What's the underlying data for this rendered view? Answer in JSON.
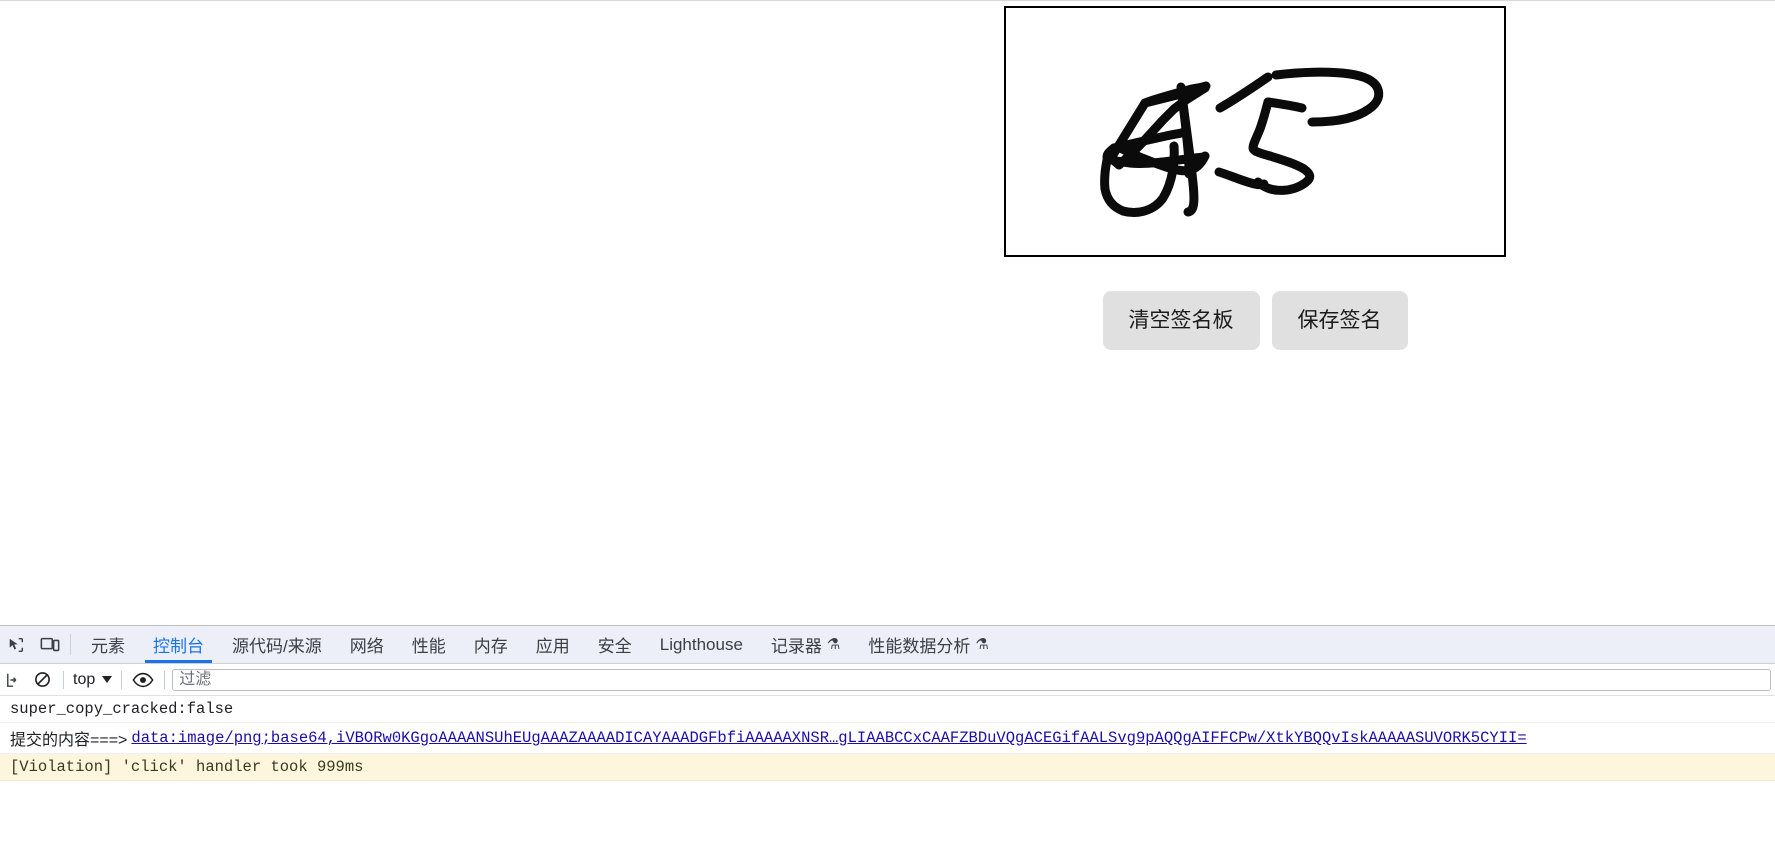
{
  "page": {
    "signature_pad": {
      "name": "signature-canvas",
      "alt_text": "handwritten signature strokes",
      "stroke_color": "#000000",
      "background": "#ffffff",
      "border_color": "#000000"
    },
    "buttons": {
      "clear_label": "清空签名板",
      "save_label": "保存签名",
      "background": "#e0e0e0"
    }
  },
  "devtools": {
    "toolbar_icons": [
      {
        "name": "inspect-element-icon",
        "title": "检查元素"
      },
      {
        "name": "device-toolbar-icon",
        "title": "切换设备工具栏"
      }
    ],
    "tabs": [
      {
        "label": "元素",
        "active": false,
        "flask": false
      },
      {
        "label": "控制台",
        "active": true,
        "flask": false
      },
      {
        "label": "源代码/来源",
        "active": false,
        "flask": false
      },
      {
        "label": "网络",
        "active": false,
        "flask": false
      },
      {
        "label": "性能",
        "active": false,
        "flask": false
      },
      {
        "label": "内存",
        "active": false,
        "flask": false
      },
      {
        "label": "应用",
        "active": false,
        "flask": false
      },
      {
        "label": "安全",
        "active": false,
        "flask": false
      },
      {
        "label": "Lighthouse",
        "active": false,
        "flask": false
      },
      {
        "label": "记录器",
        "active": false,
        "flask": true
      },
      {
        "label": "性能数据分析",
        "active": false,
        "flask": true
      }
    ],
    "active_tab_color": "#1a73e8",
    "tabbar_background": "#eceff8",
    "console_toolbar": {
      "clear_console_icon": "clear-console-icon",
      "no_messages_icon": "block-icon",
      "context_value": "top",
      "eye_icon": "live-expression-eye-icon",
      "filter_placeholder": "过滤",
      "filter_value": ""
    },
    "console_messages": [
      {
        "kind": "log",
        "text": "super_copy_cracked:false"
      },
      {
        "kind": "log-link",
        "prefix": "提交的内容===>",
        "link_text": "data:image/png;base64,iVBORw0KGgoAAAANSUhEUgAAAZAAAADICAYAAADGFbfiAAAAAXNSR…gLIAABCCxCAAFZBDuVQgACEGifAALSvg9pAQQgAIFFCPw/XtkYBQQvIskAAAAASUVORK5CYII=",
        "link_color": "#1a0dab"
      },
      {
        "kind": "violation",
        "text": "[Violation] 'click' handler took 999ms",
        "background": "#fdf6dd"
      }
    ]
  }
}
